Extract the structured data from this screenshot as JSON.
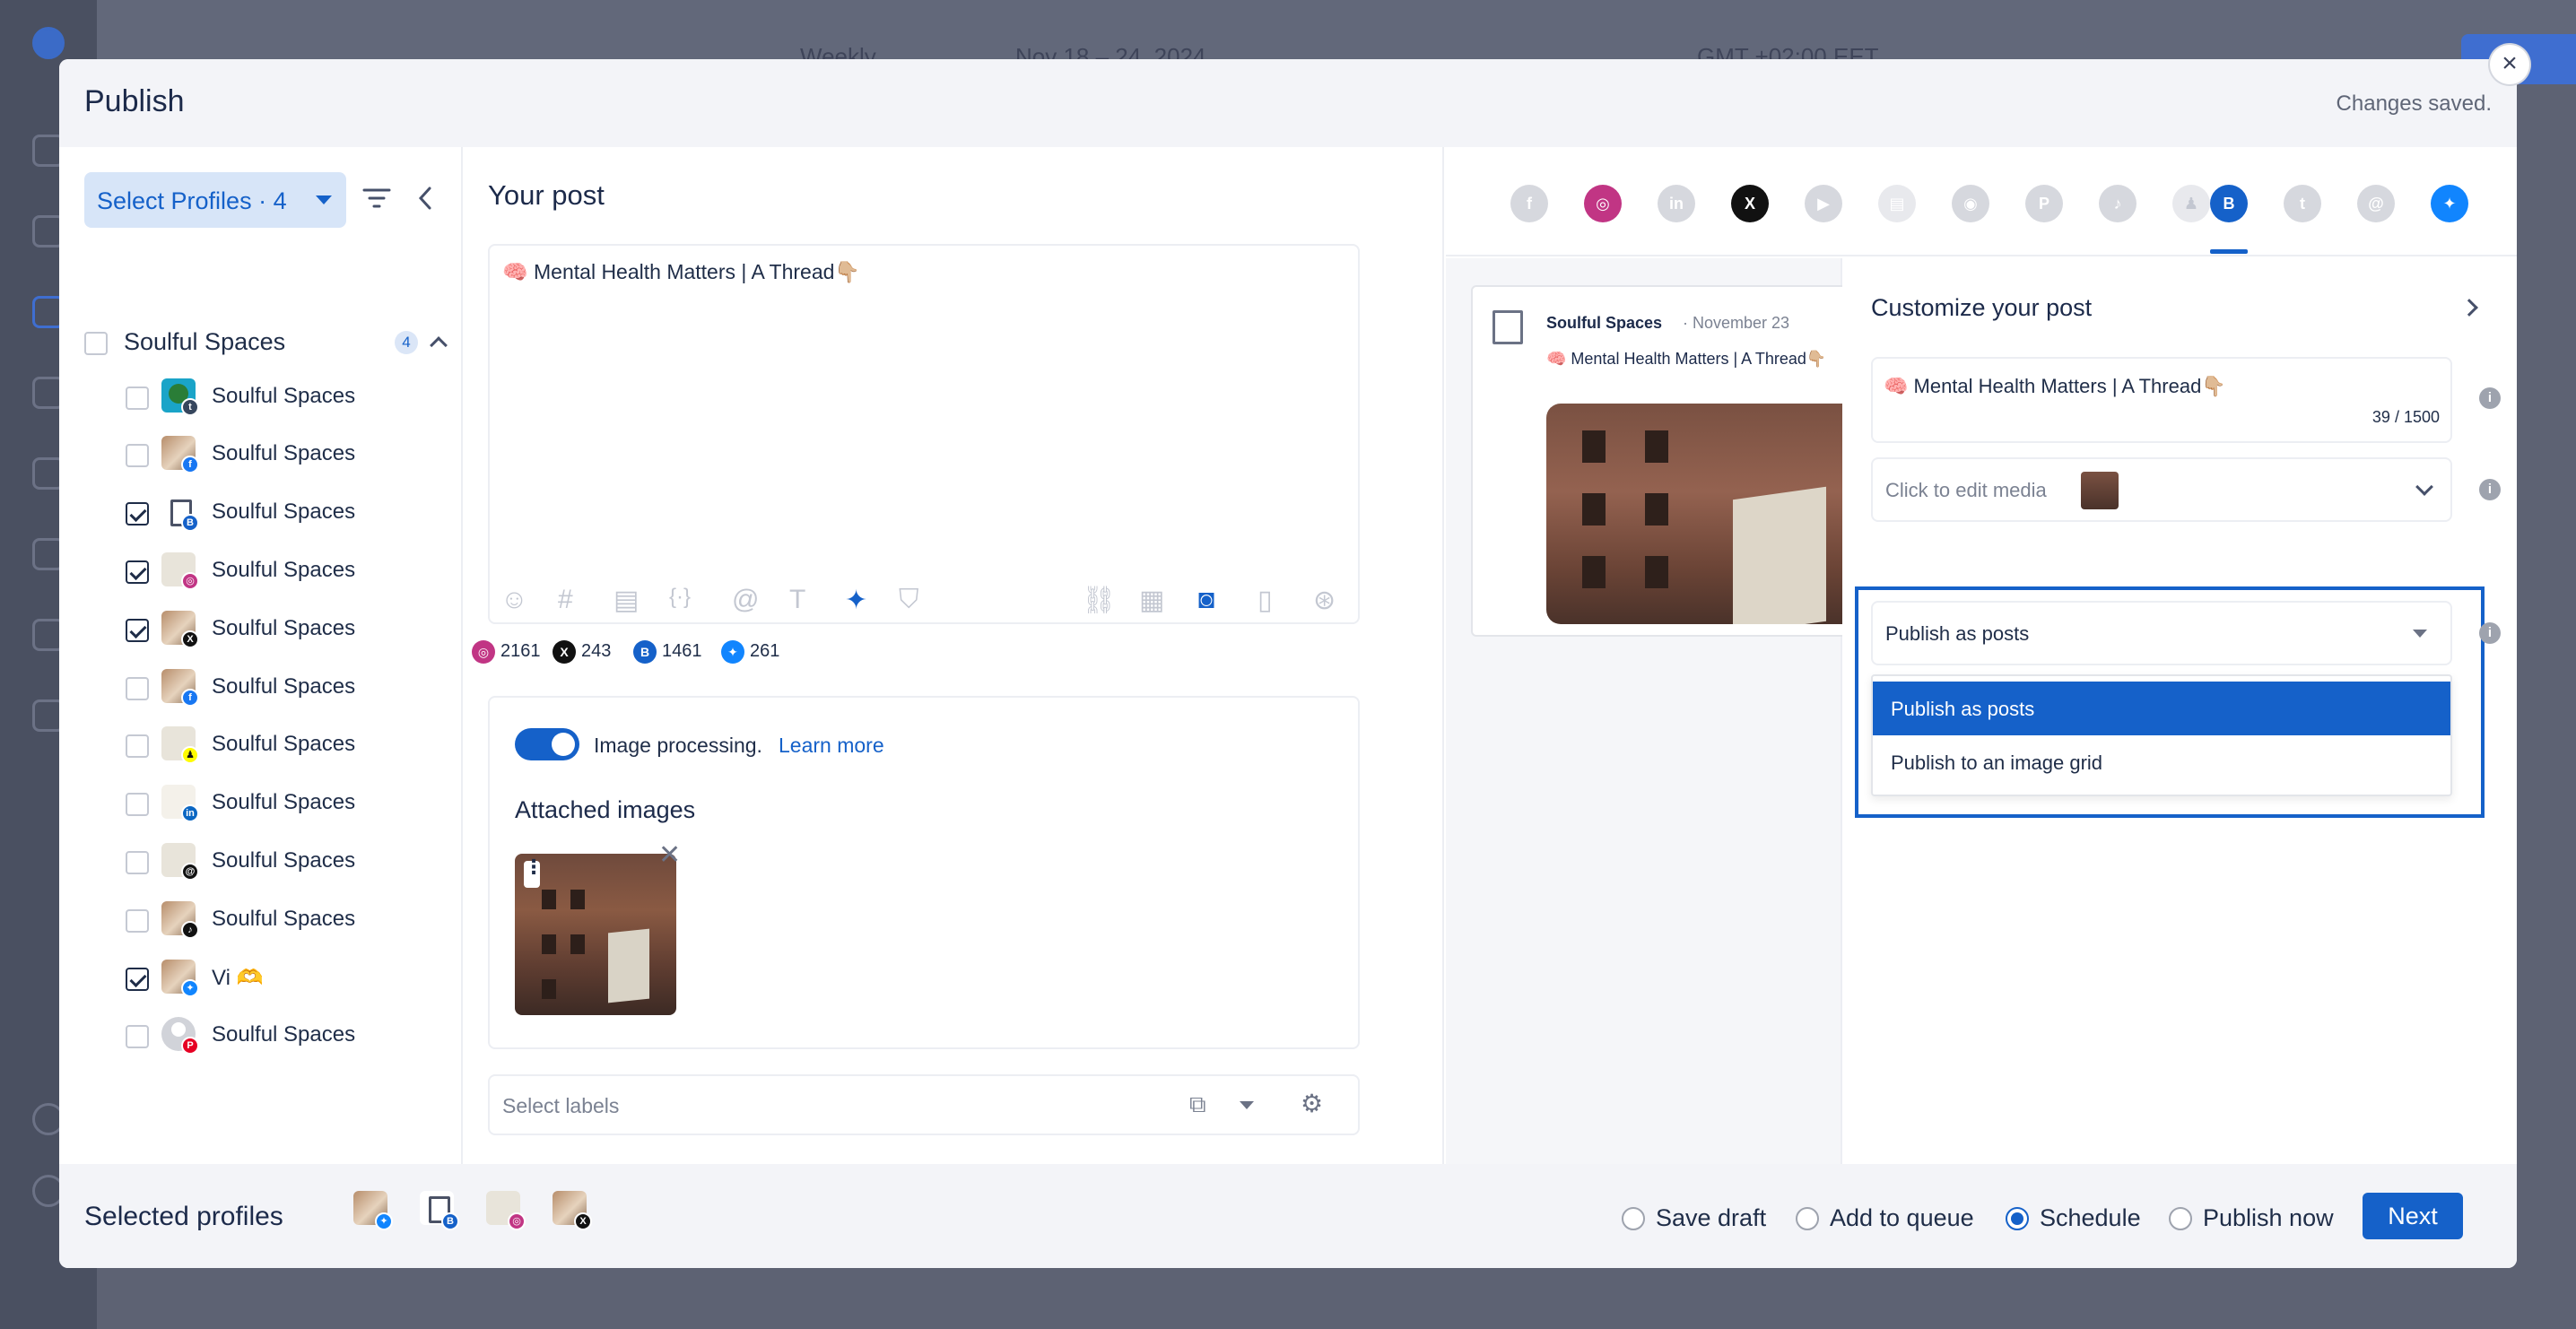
{
  "background": {
    "range": "Nov 18 – 24, 2024",
    "view": "Weekly",
    "timezone": "GMT +02:00 EET"
  },
  "modal": {
    "title": "Publish",
    "status": "Changes saved.",
    "close_icon": "close-icon"
  },
  "profiles": {
    "select_label": "Select Profiles · 4",
    "group": {
      "name": "Soulful Spaces",
      "count": "4"
    },
    "items": [
      {
        "name": "Soulful Spaces",
        "network": "tumblr",
        "checked": false
      },
      {
        "name": "Soulful Spaces",
        "network": "facebook",
        "checked": false
      },
      {
        "name": "Soulful Spaces",
        "network": "google-business",
        "checked": true
      },
      {
        "name": "Soulful Spaces",
        "network": "instagram",
        "checked": true
      },
      {
        "name": "Soulful Spaces",
        "network": "x",
        "checked": true
      },
      {
        "name": "Soulful Spaces",
        "network": "facebook",
        "checked": false
      },
      {
        "name": "Soulful Spaces",
        "network": "snapchat",
        "checked": false
      },
      {
        "name": "Soulful Spaces",
        "network": "linkedin",
        "checked": false
      },
      {
        "name": "Soulful Spaces",
        "network": "threads",
        "checked": false
      },
      {
        "name": "Soulful Spaces",
        "network": "tiktok",
        "checked": false
      },
      {
        "name": "Vi 🫶",
        "network": "bluesky",
        "checked": true
      },
      {
        "name": "Soulful Spaces",
        "network": "pinterest",
        "checked": false
      }
    ]
  },
  "post": {
    "heading": "Your post",
    "text": "🧠 Mental Health Matters | A Thread👇🏼",
    "counts": [
      {
        "network": "instagram",
        "value": "2161"
      },
      {
        "network": "x",
        "value": "243"
      },
      {
        "network": "google-business",
        "value": "1461"
      },
      {
        "network": "bluesky",
        "value": "261"
      }
    ],
    "image_processing": "Image processing.",
    "learn_more": "Learn more",
    "attached_images": "Attached images",
    "labels_placeholder": "Select labels"
  },
  "networks": [
    "facebook",
    "instagram",
    "linkedin",
    "x",
    "youtube",
    "google-business",
    "reddit",
    "pinterest",
    "tiktok",
    "snapchat",
    "google-business-active",
    "tumblr",
    "threads",
    "bluesky"
  ],
  "preview": {
    "name": "Soulful Spaces",
    "date": "· November 23",
    "text": "🧠 Mental Health Matters | A Thread👇🏼"
  },
  "customize": {
    "title": "Customize your post",
    "text": "🧠 Mental Health Matters | A Thread👇🏼",
    "char_count": "39 / 1500",
    "media_placeholder": "Click to edit media",
    "publish_mode": "Publish as posts",
    "options": [
      "Publish as posts",
      "Publish to an image grid"
    ]
  },
  "footer": {
    "selected_label": "Selected profiles",
    "actions": [
      "Save draft",
      "Add to queue",
      "Schedule",
      "Publish now"
    ],
    "selected_action": "Schedule",
    "next": "Next"
  },
  "colors": {
    "accent": "#1561c9",
    "overlay": "#5d6273"
  }
}
